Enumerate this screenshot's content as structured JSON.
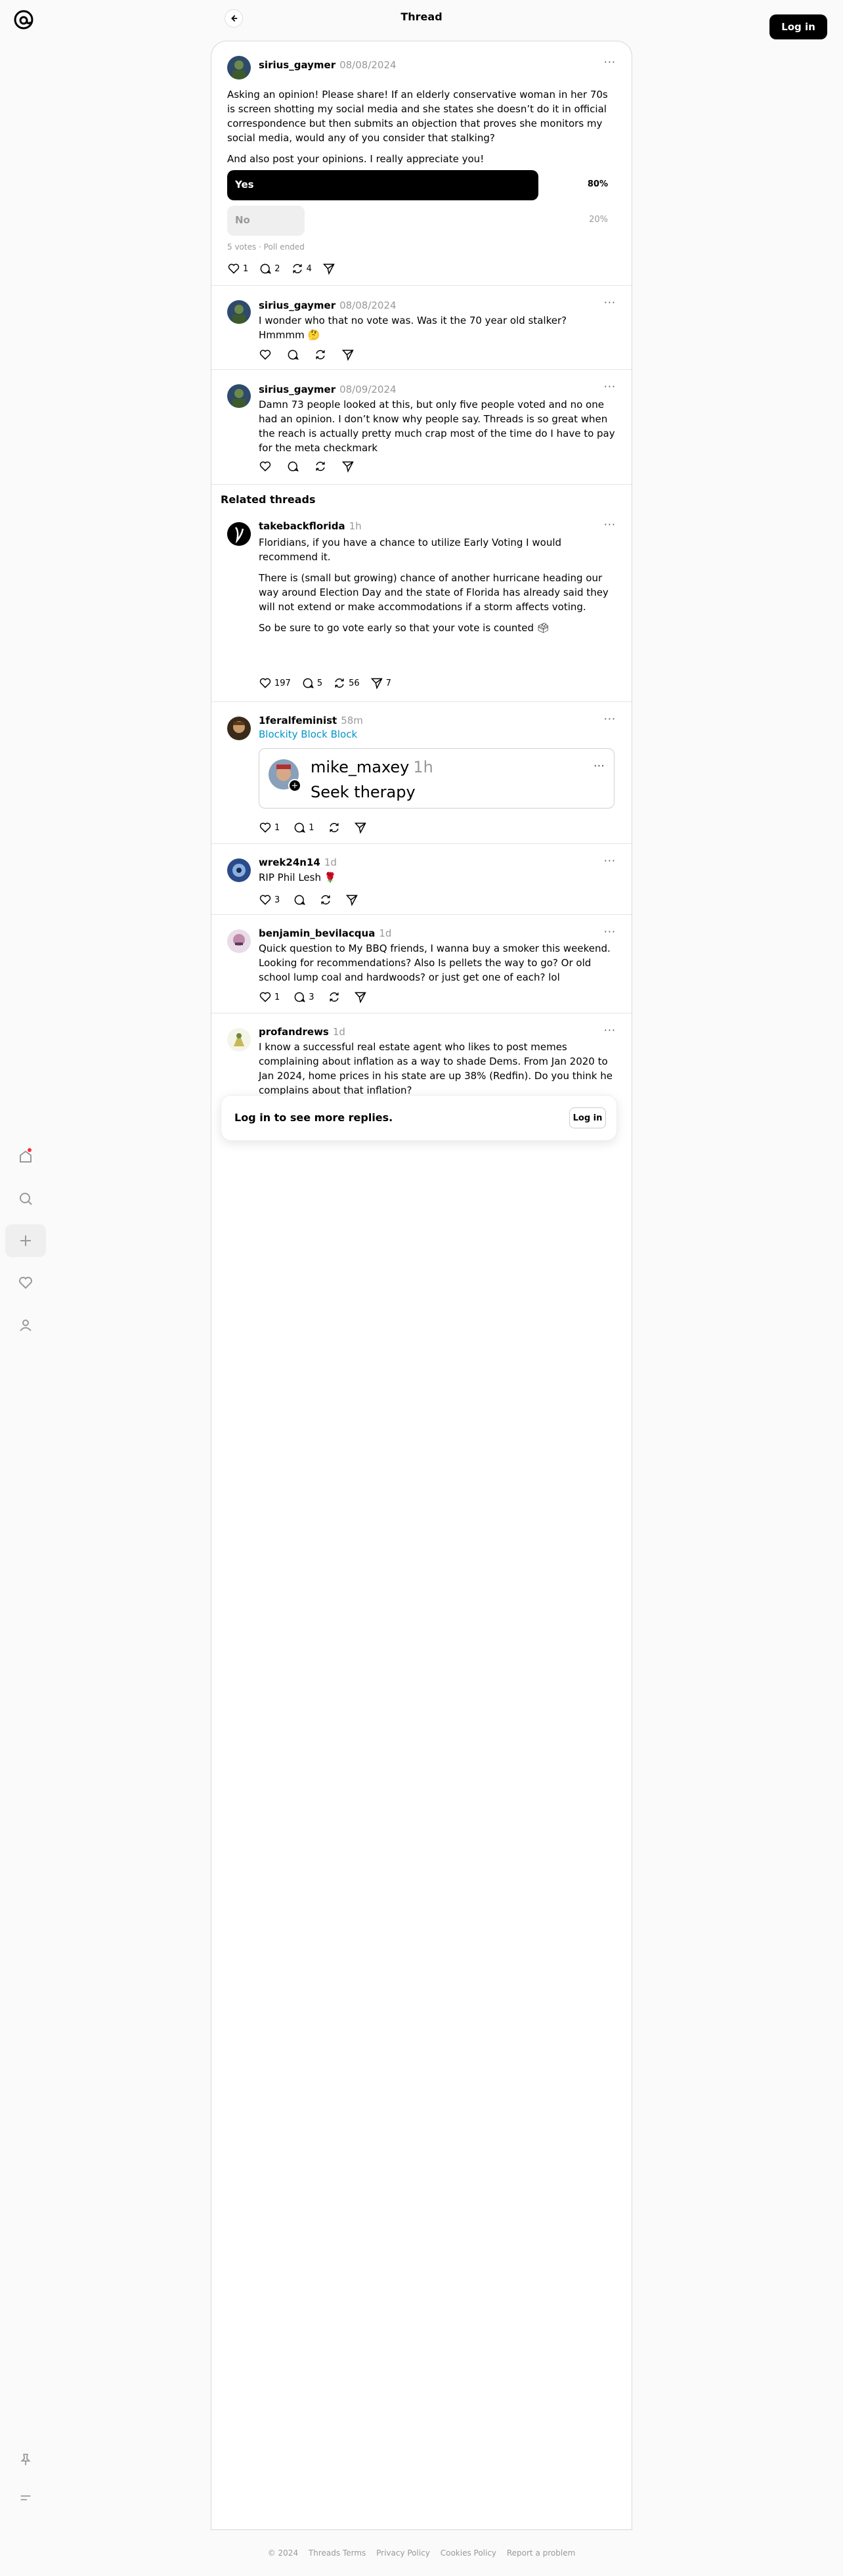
{
  "header": {
    "title": "Thread",
    "login_label": "Log in"
  },
  "main_post": {
    "username": "sirius_gaymer",
    "date": "08/08/2024",
    "text1": "Asking an opinion! Please share! If an elderly conservative woman in her 70s is screen shotting my social media and she states she doesn’t do it in official correspondence but then submits an objection that proves she monitors my social media, would any of you consider that stalking?",
    "text2": "And also post your opinions. I really appreciate you!",
    "poll": [
      {
        "label": "Yes",
        "pct": "80%",
        "value": 0.8
      },
      {
        "label": "No",
        "pct": "20%",
        "value": 0.2
      }
    ],
    "poll_meta": "5 votes · Poll ended",
    "likes": "1",
    "replies": "2",
    "reposts": "4"
  },
  "replies": [
    {
      "username": "sirius_gaymer",
      "date": "08/08/2024",
      "text": "I wonder who that no vote was. Was it the 70 year old stalker? Hmmmm 🤔"
    },
    {
      "username": "sirius_gaymer",
      "date": "08/09/2024",
      "text": "Damn 73 people looked at this, but only five people voted and no one had an opinion. I don’t know why people say. Threads is so great when the reach is actually pretty much crap most of the time do I have to pay for the meta checkmark"
    }
  ],
  "related": {
    "heading": "Related threads",
    "posts": [
      {
        "username": "takebackflorida",
        "time": "1h",
        "p1": "Floridians, if you have a chance to utilize Early Voting I would recommend it.",
        "p2": "There is (small but growing) chance of another hurricane heading our way around Election Day and the state of Florida has already said they will not extend or make accommodations if a storm affects voting.",
        "p3": "So be sure to go vote early so that your vote is counted 🗳",
        "likes": "197",
        "replies": "5",
        "reposts": "56",
        "shares": "7"
      },
      {
        "username": "1feralfeminist",
        "time": "58m",
        "link": "Blockity Block Block",
        "quote": {
          "username": "mike_maxey",
          "time": "1h",
          "text": "Seek therapy"
        },
        "likes": "1",
        "replies": "1"
      },
      {
        "username": "wrek24n14",
        "time": "1d",
        "text": "RIP Phil Lesh 🌹",
        "likes": "3"
      },
      {
        "username": "benjamin_bevilacqua",
        "time": "1d",
        "text": "Quick question to My BBQ friends, I wanna buy a smoker this weekend. Looking for recommendations? Also Is pellets the way to go? Or old school lump coal and hardwoods? or just get one of each? lol",
        "likes": "1",
        "replies": "3"
      },
      {
        "username": "profandrews",
        "time": "1d",
        "text": "I know a successful real estate agent who likes to post memes complaining about inflation as a way to shade Dems. From Jan 2020 to Jan 2024, home prices in his state are up 38% (Redfin). Do you think he complains about that inflation?"
      }
    ]
  },
  "login_prompt": {
    "text": "Log in to see more replies.",
    "button": "Log in"
  },
  "footer": [
    "© 2024",
    "Threads Terms",
    "Privacy Policy",
    "Cookies Policy",
    "Report a problem"
  ],
  "colors": {
    "poll_winner": "#000000",
    "poll_loser": "#efefef",
    "link": "#0095c8",
    "notification": "#ff3040"
  }
}
